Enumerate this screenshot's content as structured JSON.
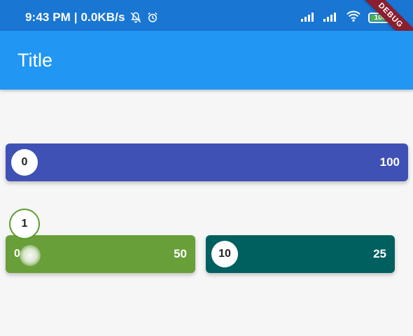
{
  "status_bar": {
    "time_speed": "9:43 PM | 0.0KB/s",
    "battery": "100",
    "icons": [
      "notifications-off-icon",
      "alarm-icon",
      "signal-icon",
      "signal-icon",
      "wifi-icon",
      "battery-icon"
    ]
  },
  "debug_banner": "DEBUG",
  "app_bar": {
    "title": "Title"
  },
  "sliders": [
    {
      "min": "0",
      "max": "100",
      "value": 0,
      "color": "#3f51b5"
    },
    {
      "min": "0",
      "max": "50",
      "value": 1,
      "value_label": "1",
      "state": "dragging",
      "color": "#689f38"
    },
    {
      "min": "10",
      "max": "25",
      "value": 10,
      "color": "#005f5f"
    }
  ],
  "colors": {
    "status_bar": "#1976d2",
    "app_bar": "#2196f3",
    "background": "#f6f6f6"
  }
}
